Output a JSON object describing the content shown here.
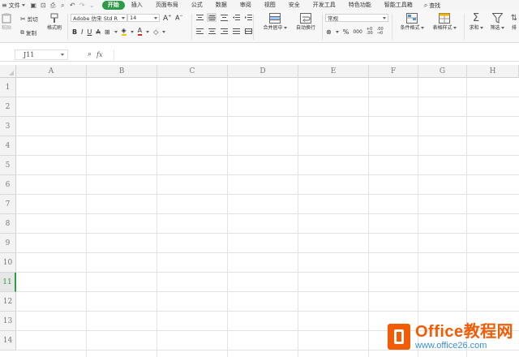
{
  "menu": {
    "file_label": "文件",
    "tabs": [
      {
        "label": "开始",
        "active": true
      },
      {
        "label": "插入"
      },
      {
        "label": "页面布局"
      },
      {
        "label": "公式"
      },
      {
        "label": "数据"
      },
      {
        "label": "审阅"
      },
      {
        "label": "视图"
      },
      {
        "label": "安全"
      },
      {
        "label": "开发工具"
      },
      {
        "label": "特色功能"
      },
      {
        "label": "智能工具箱"
      }
    ],
    "search_label": "查找"
  },
  "ribbon": {
    "paste_label": "粘贴",
    "cut_label": "剪切",
    "copy_label": "复制",
    "format_painter_label": "格式刷",
    "font_name": "Adobe 仿宋 Std R",
    "font_size": "14",
    "number_format": "常规",
    "merge_center_label": "合并居中",
    "wrap_text_label": "自动换行",
    "conditional_format_label": "条件格式",
    "table_style_label": "表格样式",
    "sum_label": "求和",
    "filter_label": "筛选",
    "sort_label": "排"
  },
  "formula_bar": {
    "cell_ref": "J11",
    "fx_label": "fx",
    "value": ""
  },
  "grid": {
    "columns": [
      "A",
      "B",
      "C",
      "D",
      "E",
      "F",
      "G",
      "H"
    ],
    "rows": [
      "1",
      "2",
      "3",
      "4",
      "5",
      "6",
      "7",
      "8",
      "9",
      "10",
      "11",
      "12",
      "13",
      "14"
    ],
    "active_row": "11"
  },
  "watermark": {
    "title_en": "Office",
    "title_cn": "教程网",
    "url": "www.office26.com"
  },
  "colors": {
    "accent_green": "#2e9b48",
    "watermark_orange": "#f25c05",
    "watermark_blue": "#3a8fd6"
  }
}
